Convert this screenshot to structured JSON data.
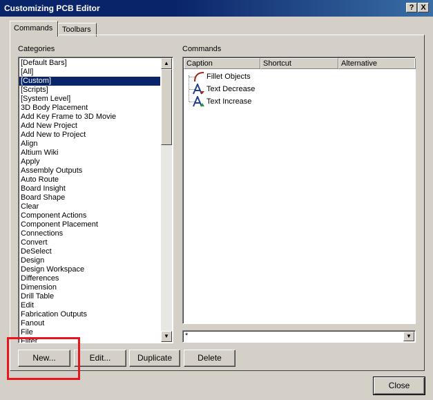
{
  "window": {
    "title": "Customizing PCB Editor",
    "help_button": "?",
    "close_button": "X"
  },
  "tabs": [
    {
      "label": "Commands",
      "active": true
    },
    {
      "label": "Toolbars",
      "active": false
    }
  ],
  "categories": {
    "label": "Categories",
    "items": [
      "[Default Bars]",
      "[All]",
      "[Custom]",
      "[Scripts]",
      "[System Level]",
      "3D Body Placement",
      "Add Key Frame to 3D Movie",
      "Add New Project",
      "Add New to Project",
      "Align",
      "Altium Wiki",
      "Apply",
      "Assembly Outputs",
      "Auto Route",
      "Board Insight",
      "Board Shape",
      "Clear",
      "Component Actions",
      "Component Placement",
      "Connections",
      "Convert",
      "DeSelect",
      "Design",
      "Design Workspace",
      "Differences",
      "Dimension",
      "Drill Table",
      "Edit",
      "Fabrication Outputs",
      "Fanout",
      "File",
      "Filter"
    ],
    "selected_index": 2
  },
  "commands": {
    "label": "Commands",
    "columns": [
      "Caption",
      "Shortcut",
      "Alternative"
    ],
    "items": [
      {
        "caption": "Fillet Objects",
        "icon": "fillet-icon"
      },
      {
        "caption": "Text Decrease",
        "icon": "text-decrease-icon"
      },
      {
        "caption": "Text Increase",
        "icon": "text-increase-icon"
      }
    ],
    "filter_value": "*"
  },
  "buttons": {
    "new": "New...",
    "edit": "Edit...",
    "duplicate": "Duplicate",
    "delete": "Delete",
    "close": "Close"
  },
  "annotation": {
    "color": "#e8141e"
  }
}
